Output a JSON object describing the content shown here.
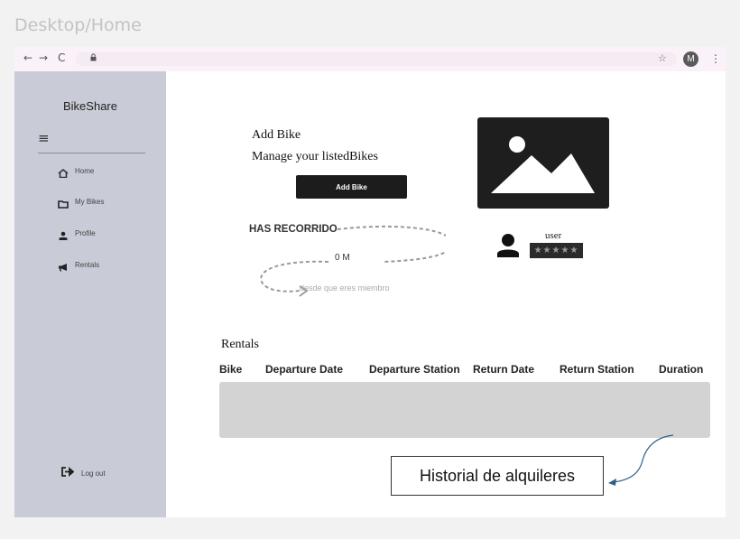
{
  "frame_title": "Desktop/Home",
  "browser": {
    "back_glyph": "←",
    "forward_glyph": "→",
    "reload_glyph": "C",
    "lock_glyph": "🔒",
    "bookmark_glyph": "☆",
    "profile_initial": "M",
    "menu_glyph": "⋮"
  },
  "sidebar": {
    "brand": "BikeShare",
    "menu_glyph": "≡",
    "items": [
      {
        "label": "Home",
        "icon": "home-icon"
      },
      {
        "label": "My Bikes",
        "icon": "folder-icon"
      },
      {
        "label": "Profile",
        "icon": "user-icon"
      },
      {
        "label": "Rentals",
        "icon": "megaphone-icon"
      }
    ],
    "logout_label": "Log out"
  },
  "main": {
    "add_bike_title": "Add Bike",
    "manage_text": "Manage your listedBikes",
    "add_bike_button": "Add Bike",
    "has_recorrido": "HAS RECORRIDO",
    "distance": "0 M",
    "since_text": "desde que eres miembro",
    "user_name": "user",
    "rating_stars": "★★★★★",
    "rentals_title": "Rentals",
    "table_headers": [
      "Bike",
      "Departure Date",
      "Departure Station",
      "Return Date",
      "Return Station",
      "Duration"
    ]
  },
  "annotation": {
    "callout_text": "Historial de alquileres"
  },
  "colors": {
    "sidebar_bg": "#c9ccd6",
    "table_bg": "#d3d3d3",
    "arrow": "#2f5f8a"
  }
}
